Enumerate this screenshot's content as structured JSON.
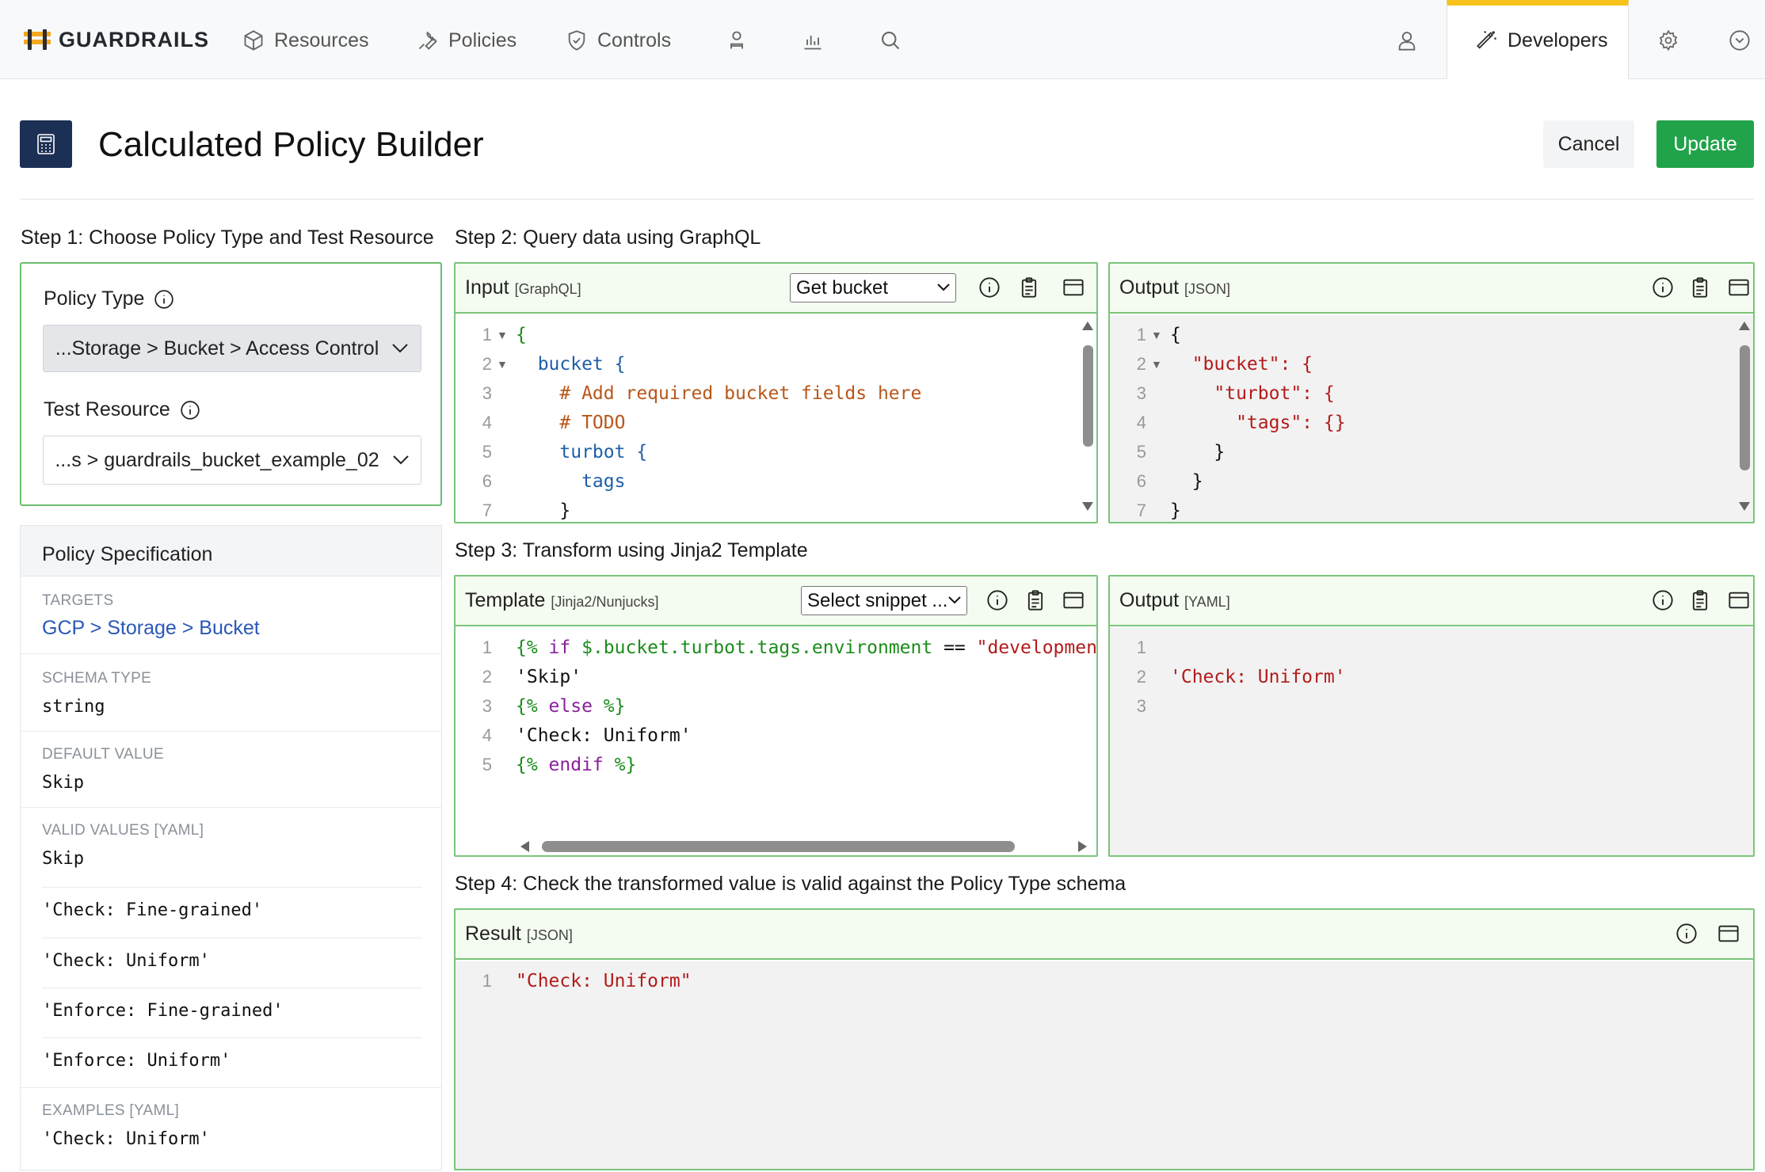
{
  "nav": {
    "brand": "GUARDRAILS",
    "resources": "Resources",
    "policies": "Policies",
    "controls": "Controls",
    "developers": "Developers"
  },
  "header": {
    "title": "Calculated Policy Builder",
    "cancel": "Cancel",
    "update": "Update"
  },
  "step1": {
    "heading": "Step 1: Choose Policy Type and Test Resource",
    "policy_type_label": "Policy Type",
    "policy_type_value": "...Storage > Bucket > Access Control",
    "test_resource_label": "Test Resource",
    "test_resource_value": "...s > guardrails_bucket_example_02"
  },
  "spec": {
    "title": "Policy Specification",
    "targets_label": "TARGETS",
    "targets_value": "GCP > Storage > Bucket",
    "schema_type_label": "SCHEMA TYPE",
    "schema_type_value": "string",
    "default_label": "DEFAULT VALUE",
    "default_value": "Skip",
    "valid_label": "VALID VALUES [YAML]",
    "valid_values": [
      "Skip",
      "'Check: Fine-grained'",
      "'Check: Uniform'",
      "'Enforce: Fine-grained'",
      "'Enforce: Uniform'"
    ],
    "examples_label": "EXAMPLES [YAML]",
    "examples_value": "'Check: Uniform'"
  },
  "step2": {
    "heading": "Step 2: Query data using GraphQL",
    "input_title": "Input",
    "input_sub": "[GraphQL]",
    "input_select": "Get bucket",
    "output_title": "Output",
    "output_sub": "[JSON]"
  },
  "step3": {
    "heading": "Step 3: Transform using Jinja2 Template",
    "template_title": "Template",
    "template_sub": "[Jinja2/Nunjucks]",
    "template_select": "Select snippet ...",
    "output_title": "Output",
    "output_sub": "[YAML]"
  },
  "step4": {
    "heading": "Step 4: Check the transformed value is valid against the Policy Type schema",
    "result_title": "Result",
    "result_sub": "[JSON]"
  },
  "code": {
    "input": [
      "{",
      "  bucket {",
      "    # Add required bucket fields here",
      "    # TODO",
      "    turbot {",
      "      tags",
      "    }"
    ],
    "output": [
      "{",
      "  \"bucket\": {",
      "    \"turbot\": {",
      "      \"tags\": {}",
      "    }",
      "  }",
      "}"
    ],
    "template": [
      "{% if $.bucket.turbot.tags.environment == \"development\"",
      "'Skip'",
      "{% else %}",
      "'Check: Uniform'",
      "{% endif %}"
    ],
    "yaml": [
      "",
      "'Check: Uniform'",
      ""
    ],
    "result": [
      "\"Check: Uniform\""
    ]
  },
  "colors": {
    "brand_yellow": "#f7c21b",
    "update_green": "#21a34a",
    "panel_border": "#7bc47b",
    "link_blue": "#2a58b8"
  }
}
